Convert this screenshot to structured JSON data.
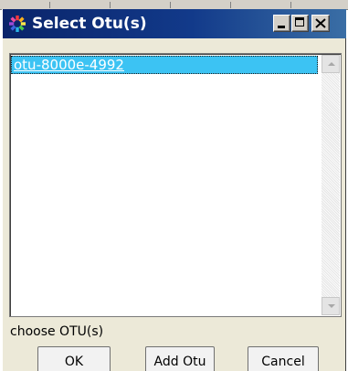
{
  "window": {
    "title": "Select Otu(s)",
    "icon": "app-gear-icon",
    "controls": [
      "minimize-icon",
      "maximize-icon",
      "close-icon"
    ]
  },
  "list": {
    "items": [
      {
        "label": "otu-8000e-4992",
        "selected": true
      }
    ],
    "selection_color": "#3cc3f3"
  },
  "status": {
    "text": "choose OTU(s)"
  },
  "buttons": {
    "ok_label": "OK",
    "add_label": "Add Otu",
    "cancel_label": "Cancel"
  },
  "colors": {
    "titlebar": "#0a246a",
    "dialog_background": "#ece9d8"
  }
}
